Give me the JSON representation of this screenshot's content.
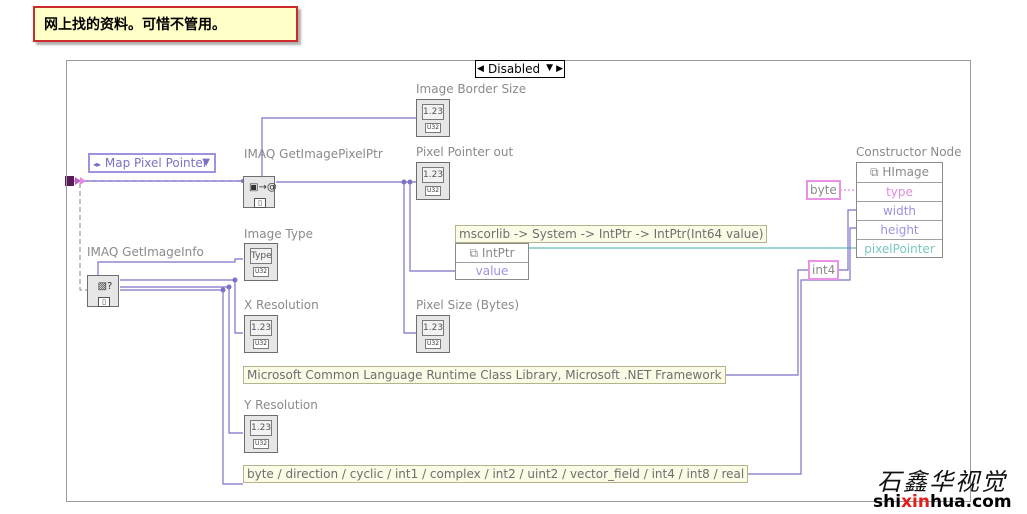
{
  "note": {
    "text": "网上找的资料。可惜不管用。"
  },
  "case_selector": {
    "value": "Disabled"
  },
  "ring": {
    "value": "Map Pixel Pointer"
  },
  "nodes": {
    "get_ptr_label": "IMAQ GetImagePixelPtr",
    "get_info_label": "IMAQ GetImageInfo"
  },
  "indicators": {
    "border_size": "Image Border Size",
    "pixel_pointer_out": "Pixel Pointer out",
    "image_type": "Image Type",
    "x_resolution": "X Resolution",
    "pixel_size": "Pixel Size (Bytes)",
    "y_resolution": "Y Resolution",
    "numeric_glyph": "1.23",
    "type_glyph": "Type",
    "u32_tag": "U32"
  },
  "constants": {
    "intptr_ctor": "mscorlib -> System -> IntPtr -> IntPtr(Int64 value)",
    "clr_lib": "Microsoft Common Language Runtime Class Library, Microsoft .NET Framework",
    "enum_list": "byte / direction / cyclic / int1 / complex / int2 / uint2 / vector_field / int4 / int8 / real"
  },
  "intptr_node": {
    "header": "IntPtr",
    "input": "value"
  },
  "constructor": {
    "label": "Constructor Node",
    "header": "HImage",
    "rows": [
      "type",
      "width",
      "height",
      "pixelPointer"
    ]
  },
  "pink_boxes": {
    "byte": "byte",
    "int4": "int4"
  },
  "watermark": {
    "site_prefix": "shi",
    "site_red": "xin",
    "site_suffix": "hua.com",
    "callig": "石鑫华视觉"
  },
  "colors": {
    "wire_blue": "#7c72c8",
    "wire_teal": "#62bfb2",
    "wire_pink": "#e38adf",
    "frame": "#9a9a9a",
    "note_border": "#cc2b2b",
    "note_bg": "#ffffc8"
  }
}
